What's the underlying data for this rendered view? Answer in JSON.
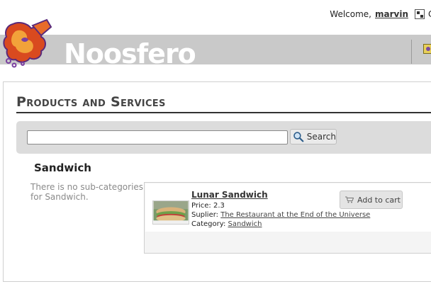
{
  "userbar": {
    "welcome": "Welcome,",
    "username": "marvin",
    "edge_text": "C"
  },
  "header": {
    "brand": "Noosfero",
    "icons": {
      "logo": "noosfero-logo-icon",
      "menu": "control-panel-icon",
      "header_right": "portrait-icon"
    }
  },
  "main": {
    "title": "Products and Services",
    "search": {
      "value": "",
      "placeholder": "",
      "button_label": "Search",
      "icon": "magnifier-icon"
    },
    "category": {
      "title": "Sandwich",
      "no_subcategories": "There is no sub-categories for Sandwich."
    },
    "products": [
      {
        "name": "Lunar Sandwich",
        "price_label": "Price:",
        "price": "2.3",
        "supplier_label": "Suplier:",
        "supplier": "The Restaurant at the End of the Universe",
        "category_label": "Category:",
        "category": "Sandwich",
        "add_to_cart": "Add to cart",
        "image": "sandwich-photo"
      }
    ]
  },
  "colors": {
    "header_band": "#c9c9c9",
    "search_panel": "#dcdcdc",
    "title_text": "#444444",
    "muted_text": "#8a8a8a"
  }
}
